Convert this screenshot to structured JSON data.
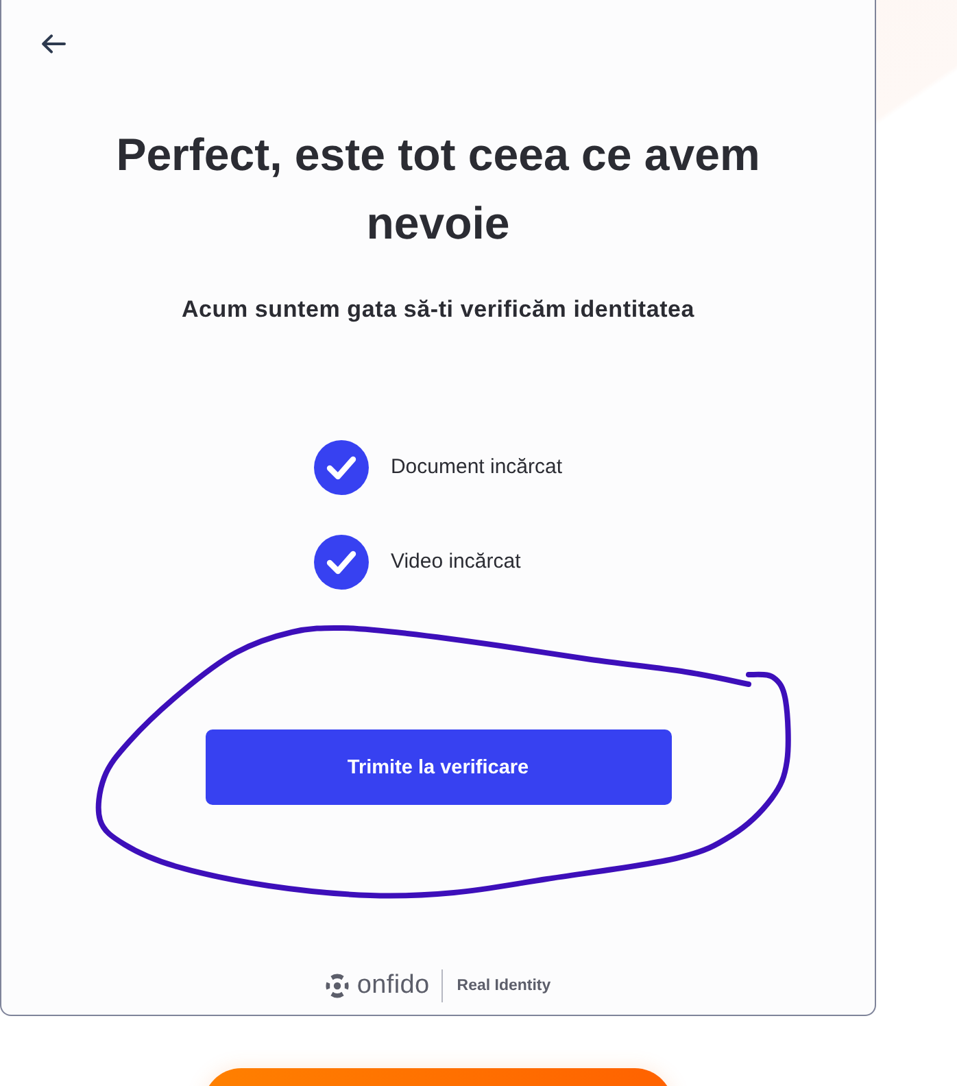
{
  "title": "Perfect, este tot ceea ce avem nevoie",
  "subtitle": "Acum suntem gata să-ti verificăm identitatea",
  "checklist": [
    {
      "label": "Document incărcat",
      "checked": true
    },
    {
      "label": "Video incărcat",
      "checked": true
    }
  ],
  "submit_button": {
    "label": "Trimite la verificare"
  },
  "footer": {
    "brand": "onfido",
    "tagline": "Real Identity"
  }
}
